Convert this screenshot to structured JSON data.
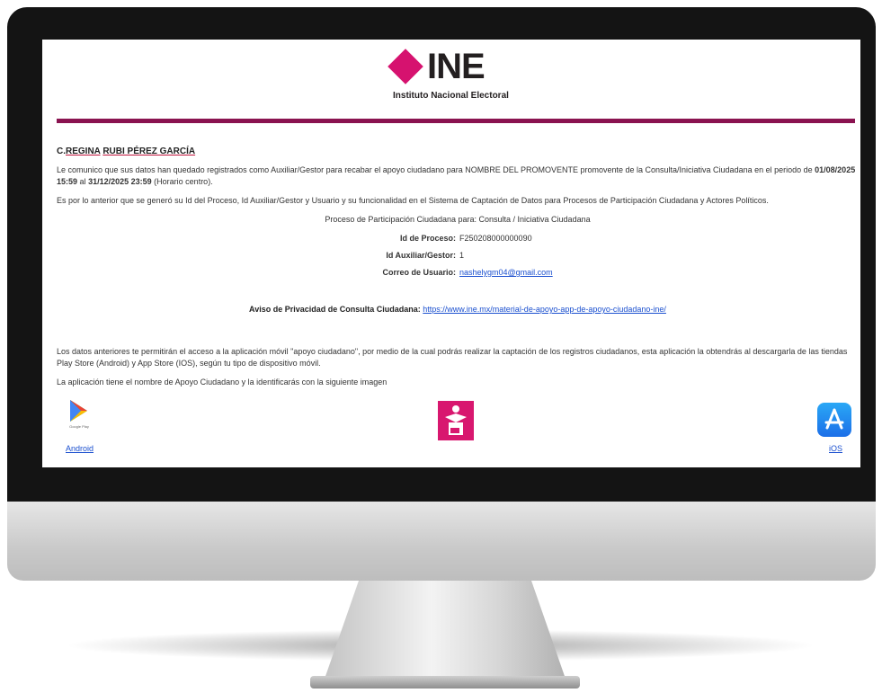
{
  "header": {
    "logo_text": "INE",
    "logo_subtitle": "Instituto Nacional Electoral"
  },
  "email": {
    "recipient_prefix": "C.",
    "recipient_first": "REGINA",
    "recipient_last": "RUBI PÉREZ GARCÍA",
    "p1": "Le comunico que sus datos han quedado registrados como Auxiliar/Gestor para recabar el apoyo ciudadano para NOMBRE DEL PROMOVENTE promovente de la Consulta/Iniciativa Ciudadana en el periodo de",
    "period_start": "01/08/2025 15:59",
    "period_mid": "al",
    "period_end": "31/12/2025 23:59",
    "p1_suffix": "(Horario centro).",
    "p2": "Es por lo anterior que se generó su Id del Proceso, Id Auxiliar/Gestor y Usuario y su funcionalidad en el Sistema de Captación de Datos para Procesos de Participación Ciudadana y Actores Políticos.",
    "process_title": "Proceso de Participación Ciudadana para: Consulta / Iniciativa Ciudadana",
    "details": [
      {
        "label": "Id de Proceso:",
        "value": "F250208000000090"
      },
      {
        "label": "Id Auxiliar/Gestor:",
        "value": "1"
      },
      {
        "label": "Correo de Usuario:",
        "value": "nashelygm04@gmail.com"
      }
    ],
    "privacy_label": "Aviso de Privacidad de Consulta Ciudadana:",
    "privacy_link": "https://www.ine.mx/material-de-apoyo-app-de-apoyo-ciudadano-ine/",
    "p3": "Los datos anteriores te permitirán el acceso a la aplicación móvil \"apoyo ciudadano\", por medio de la cual podrás realizar la captación de los registros ciudadanos, esta aplicación la obtendrás al descargarla de las tiendas Play Store (Android) y App Store (IOS), según tu tipo de dispositivo móvil.",
    "p4": "La aplicación tiene el nombre de Apoyo Ciudadano y la identificarás con la siguiente imagen"
  },
  "apps": {
    "google_play_caption": "Google Play",
    "android_label": "Android",
    "ios_label": "iOS"
  },
  "colors": {
    "ine_magenta": "#d6126f",
    "divider": "#8a1350",
    "link": "#1a4fcf"
  }
}
